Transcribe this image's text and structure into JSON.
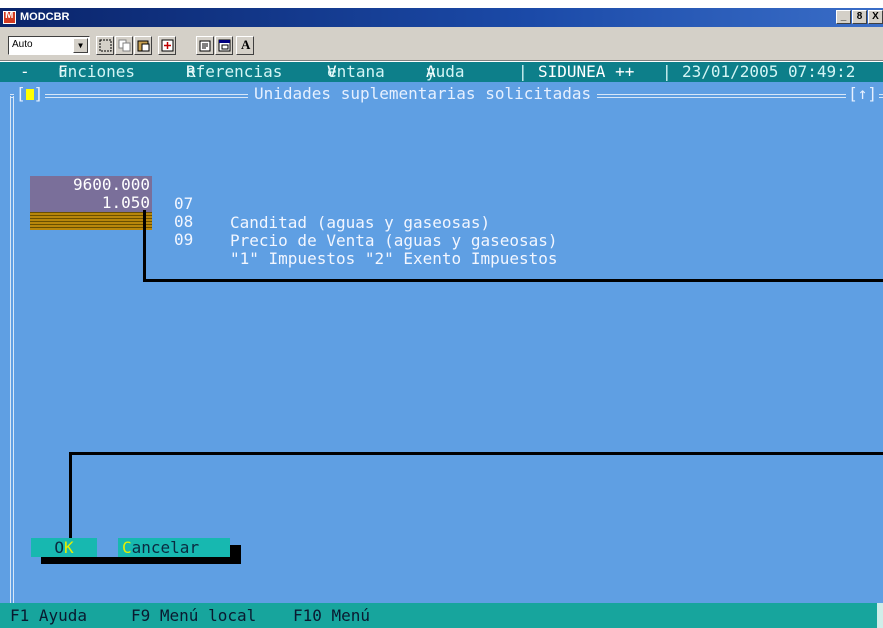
{
  "window": {
    "title": "MODCBR",
    "controls": [
      "_",
      "8",
      "X"
    ]
  },
  "toolbar": {
    "font_select_value": "Auto",
    "text_button_label": "A"
  },
  "menu": {
    "dash": "-",
    "items": [
      {
        "hot": "F",
        "rest": "unciones"
      },
      {
        "hot": "R",
        "rest": "eferencias"
      },
      {
        "hot": "V",
        "rest": "entana"
      },
      {
        "hot": "A",
        "rest": "yuda"
      }
    ],
    "separator": "|",
    "system": "SIDUNEA ++",
    "datetime": "23/01/2005 07:49:2"
  },
  "dialog": {
    "title": "Unidades suplementarias solicitadas",
    "left_mark_open": "[",
    "left_mark_close": "]",
    "right_mark": "[↑]",
    "rows": [
      {
        "value": "9600.000",
        "code": "07",
        "description": "Canditad (aguas y gaseosas)"
      },
      {
        "value": "1.050",
        "code": "08",
        "description": "Precio de Venta (aguas y gaseosas)"
      },
      {
        "value": "",
        "code": "09",
        "description": "\"1\" Impuestos \"2\" Exento Impuestos"
      }
    ],
    "ok": {
      "pre": "O",
      "hot": "K",
      "post": ""
    },
    "cancel": {
      "pre": "",
      "hot": "C",
      "post": "ancelar"
    }
  },
  "statusbar": {
    "items": [
      "F1 Ayuda",
      "F9 Menú local",
      "F10 Menú"
    ]
  },
  "colors": {
    "background": "#5f9fe3",
    "menubar": "#0d7f8a",
    "statusbar": "#17a59d",
    "value_field": "#7a6f9a",
    "button": "#17b8b0",
    "hotkey": "#e8f000"
  }
}
